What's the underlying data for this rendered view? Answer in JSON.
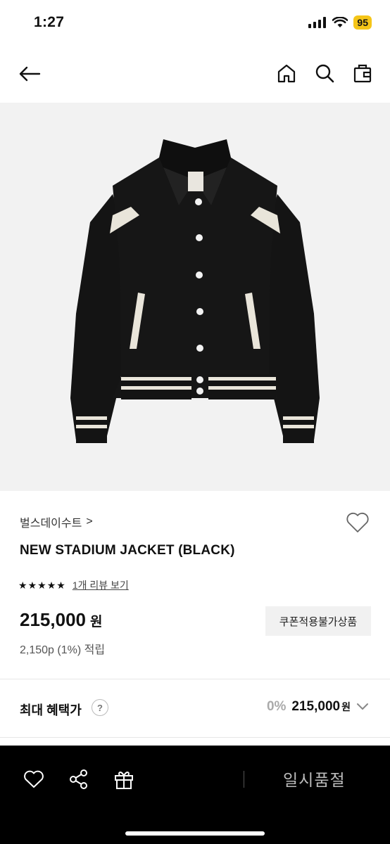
{
  "status_bar": {
    "time": "1:27",
    "battery": "95"
  },
  "product": {
    "brand": "벌스데이수트",
    "brand_chevron": ">",
    "name": "NEW STADIUM JACKET (BLACK)",
    "rating": 5,
    "review_link": "1개 리뷰 보기",
    "price": "215,000",
    "price_unit": "원",
    "coupon_badge": "쿠폰적용불가상품",
    "points": "2,150p (1%) 적립"
  },
  "benefit": {
    "label": "최대 혜택가",
    "help": "?",
    "percent": "0%",
    "price": "215,000",
    "unit": "원"
  },
  "bottom_bar": {
    "soldout": "일시품절"
  },
  "icons": {
    "back": "arrow-left-icon",
    "home": "home-icon",
    "search": "search-icon",
    "cart": "shopping-bag-icon",
    "wish": "heart-icon",
    "share": "share-icon",
    "gift": "gift-icon",
    "chevron": "chevron-down-icon",
    "star": "star-icon"
  },
  "colors": {
    "battery": "#f5c518",
    "bottom_bar": "#000000",
    "hero_bg": "#f2f2f2"
  }
}
